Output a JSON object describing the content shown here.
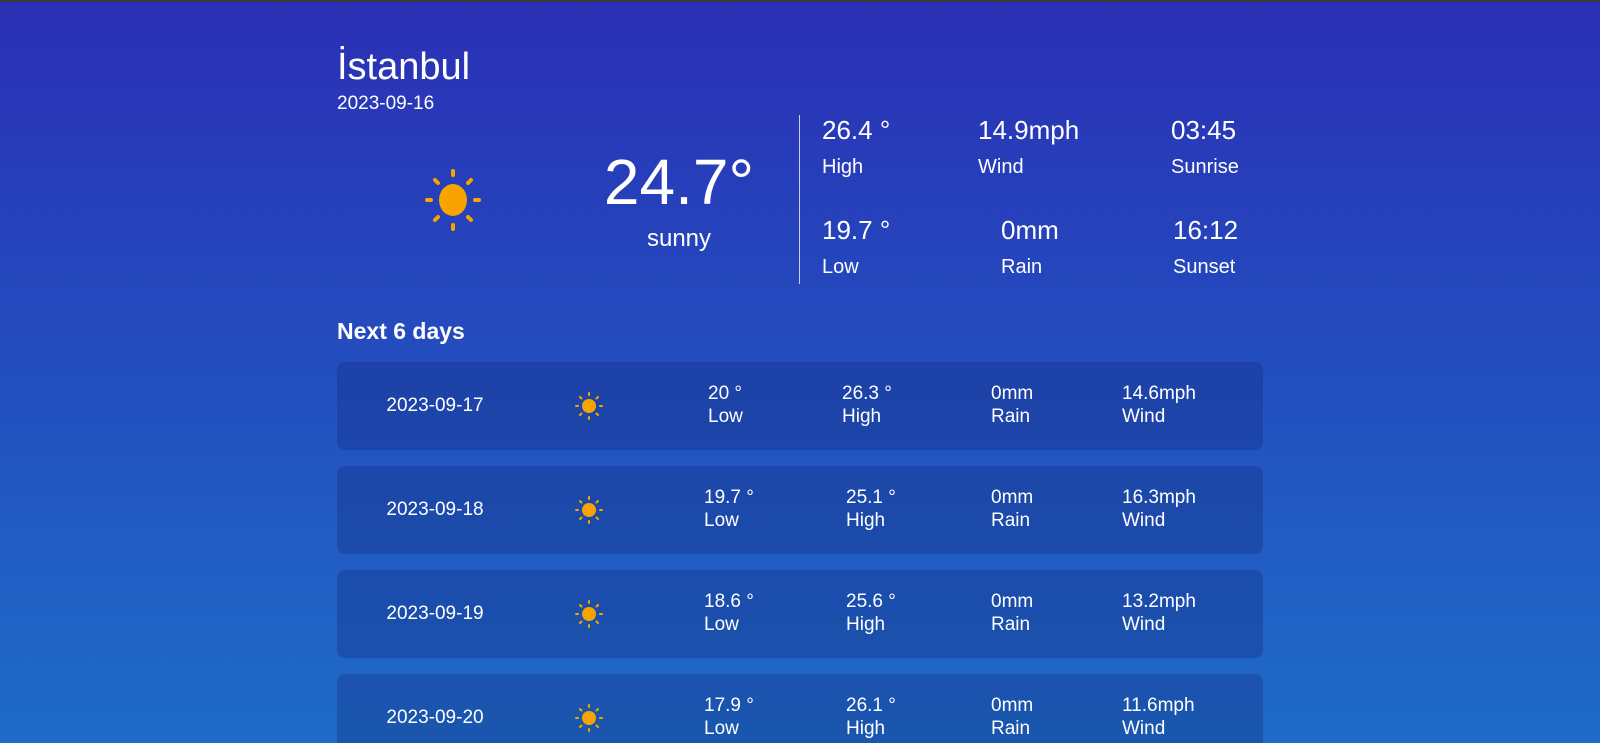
{
  "current": {
    "city": "İstanbul",
    "date": "2023-09-16",
    "icon": "sun-icon",
    "temp": "24.7°",
    "condition": "sunny",
    "stats": {
      "high": {
        "value": "26.4 °",
        "label": "High"
      },
      "wind": {
        "value": "14.9mph",
        "label": "Wind"
      },
      "sunrise": {
        "value": "03:45",
        "label": "Sunrise"
      },
      "low": {
        "value": "19.7 °",
        "label": "Low"
      },
      "rain": {
        "value": "0mm",
        "label": "Rain"
      },
      "sunset": {
        "value": "16:12",
        "label": "Sunset"
      }
    }
  },
  "forecast": {
    "title": "Next 6 days",
    "days": [
      {
        "date": "2023-09-17",
        "icon": "sun-icon",
        "low": "20 °",
        "low_label": "Low",
        "high": "26.3 °",
        "high_label": "High",
        "rain": "0mm",
        "rain_label": "Rain",
        "wind": "14.6mph",
        "wind_label": "Wind"
      },
      {
        "date": "2023-09-18",
        "icon": "sun-icon",
        "low": "19.7 °",
        "low_label": "Low",
        "high": "25.1 °",
        "high_label": "High",
        "rain": "0mm",
        "rain_label": "Rain",
        "wind": "16.3mph",
        "wind_label": "Wind"
      },
      {
        "date": "2023-09-19",
        "icon": "sun-icon",
        "low": "18.6 °",
        "low_label": "Low",
        "high": "25.6 °",
        "high_label": "High",
        "rain": "0mm",
        "rain_label": "Rain",
        "wind": "13.2mph",
        "wind_label": "Wind"
      },
      {
        "date": "2023-09-20",
        "icon": "sun-icon",
        "low": "17.9 °",
        "low_label": "Low",
        "high": "26.1 °",
        "high_label": "High",
        "rain": "0mm",
        "rain_label": "Rain",
        "wind": "11.6mph",
        "wind_label": "Wind"
      }
    ]
  },
  "colors": {
    "sun": "#f7a400",
    "background_top": "#2b2fb5",
    "background_bottom": "#1e6cc8"
  }
}
